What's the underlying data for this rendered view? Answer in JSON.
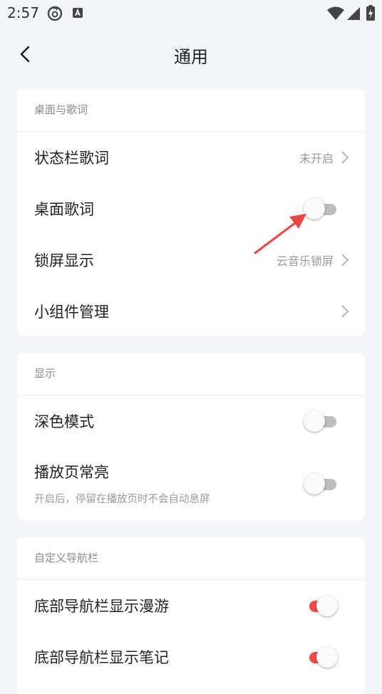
{
  "status_bar": {
    "time": "2:57",
    "left_icons": [
      "netease-cloud-music-icon",
      "keyboard-a-icon"
    ],
    "right_icons": [
      "wifi-icon",
      "cellular-signal-icon",
      "battery-charging-icon"
    ]
  },
  "header": {
    "back_icon": "chevron-left-icon",
    "title": "通用"
  },
  "sections": [
    {
      "header": "桌面与歌词",
      "items": [
        {
          "label": "状态栏歌词",
          "value": "未开启",
          "control": "chevron"
        },
        {
          "label": "桌面歌词",
          "control": "toggle",
          "on": false
        },
        {
          "label": "锁屏显示",
          "value": "云音乐锁屏",
          "control": "chevron"
        },
        {
          "label": "小组件管理",
          "control": "chevron"
        }
      ]
    },
    {
      "header": "显示",
      "items": [
        {
          "label": "深色模式",
          "control": "toggle",
          "on": false
        },
        {
          "label": "播放页常亮",
          "subtitle": "开启后，停留在播放页时不会自动息屏",
          "control": "toggle",
          "on": false
        }
      ]
    },
    {
      "header": "自定义导航栏",
      "items": [
        {
          "label": "底部导航栏显示漫游",
          "control": "toggle",
          "on": true
        },
        {
          "label": "底部导航栏显示笔记",
          "control": "toggle",
          "on": true
        }
      ]
    }
  ],
  "annotation": {
    "type": "arrow",
    "points_to": "桌面歌词",
    "color": "#ef4444"
  },
  "colors": {
    "accent": "#f04a45",
    "background": "#f3f5f8",
    "card": "#ffffff"
  }
}
